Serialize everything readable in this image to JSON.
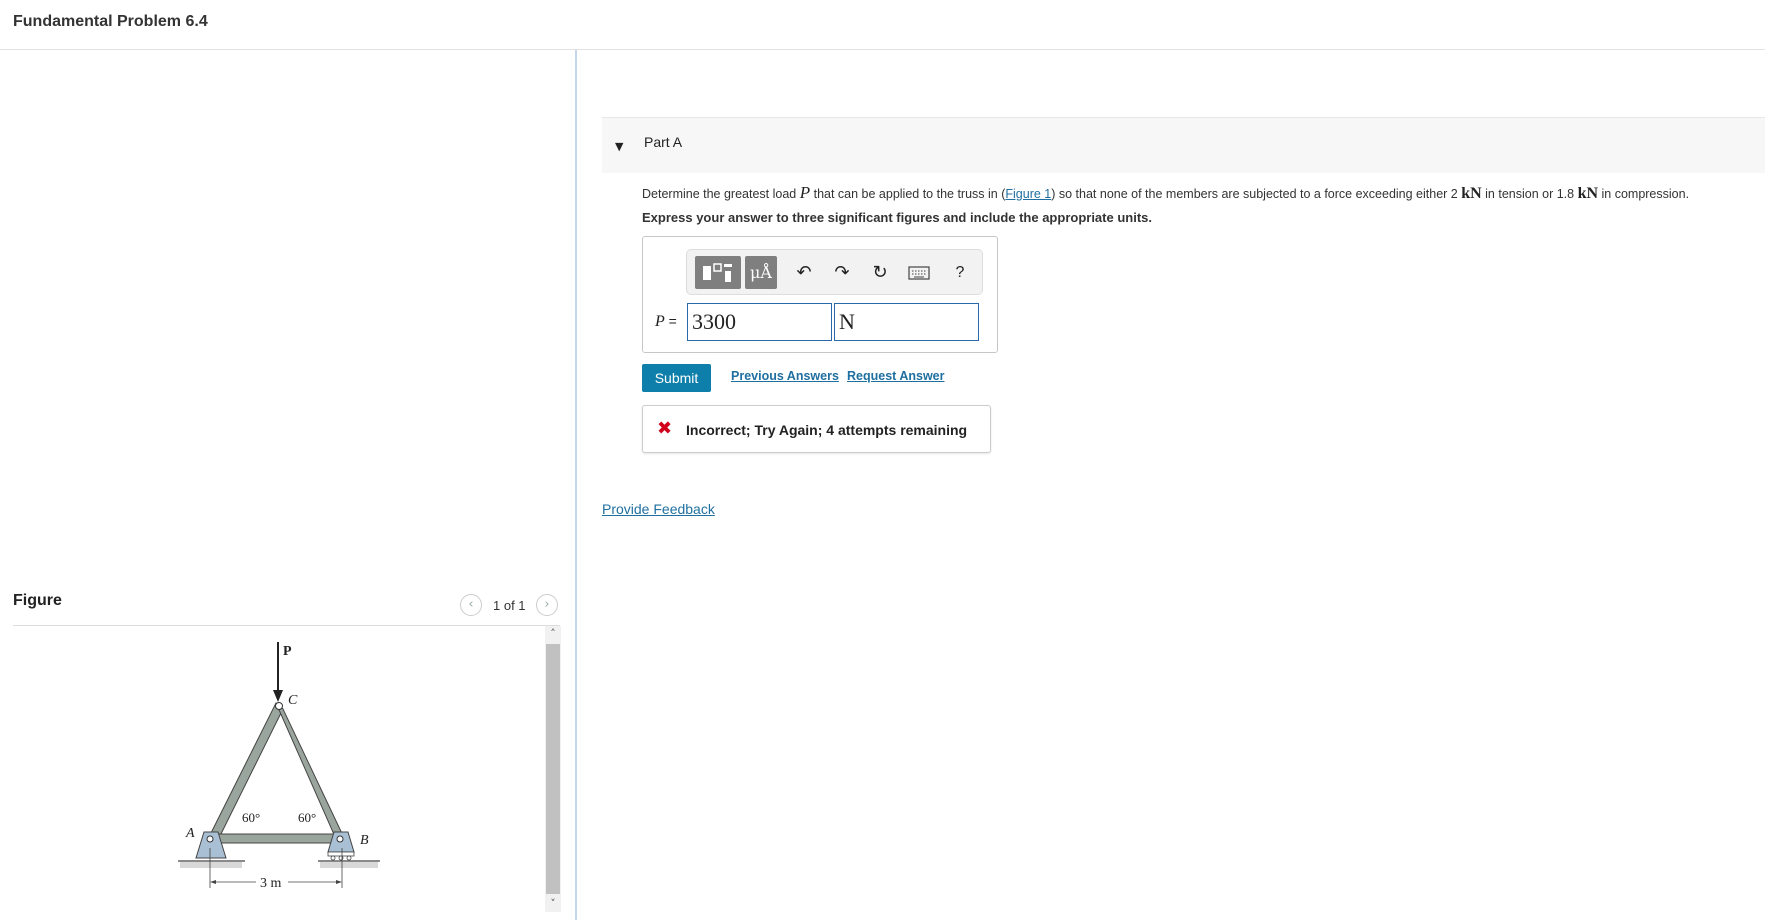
{
  "header": {
    "title": "Fundamental Problem 6.4"
  },
  "figure_panel": {
    "label": "Figure",
    "counter": "1 of 1",
    "prev_icon": "chevron-left-icon",
    "next_icon": "chevron-right-icon",
    "diagram": {
      "load_label": "P",
      "node_a": "A",
      "node_b": "B",
      "node_c": "C",
      "angle_left": "60°",
      "angle_right": "60°",
      "span": "3 m"
    }
  },
  "part": {
    "title": "Part A",
    "question_pre": "Determine the greatest load ",
    "question_var": "P",
    "question_mid": " that can be applied to the truss in (",
    "figure_link": "Figure 1",
    "question_mid2": ") so that none of the members are subjected to a force exceeding either 2 ",
    "unit_kn_1": "kN",
    "question_mid3": " in tension or 1.8 ",
    "unit_kn_2": "kN",
    "question_post": " in compression.",
    "instruction": "Express your answer to three significant figures and include the appropriate units."
  },
  "toolbar": {
    "templates_icon": "templates-icon",
    "units_label": "μÅ",
    "undo_icon": "undo-icon",
    "redo_icon": "redo-icon",
    "reset_icon": "reset-icon",
    "keyboard_icon": "keyboard-icon",
    "help_label": "?"
  },
  "answer": {
    "var_label": "P",
    "equals": "=",
    "value": "3300",
    "unit": "N"
  },
  "actions": {
    "submit": "Submit",
    "previous_answers": "Previous Answers",
    "request_answer": "Request Answer"
  },
  "feedback": {
    "icon": "x-icon",
    "message": "Incorrect; Try Again; 4 attempts remaining",
    "color": "#d0021b"
  },
  "provide_feedback": "Provide Feedback",
  "colors": {
    "submit": "#0e7faa",
    "link": "#1f6fa0",
    "input_border": "#2a6aa8"
  }
}
